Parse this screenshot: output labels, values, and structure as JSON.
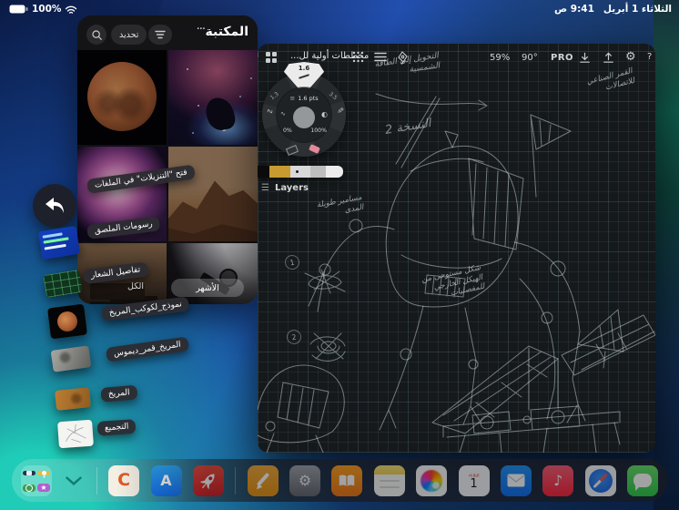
{
  "status_bar": {
    "battery_percent": "100%",
    "time": "9:41 ص",
    "date": "الثلاثاء 1 أبريل"
  },
  "photos": {
    "title": "المكتبة",
    "more_label": "···",
    "select_label": "تحديد",
    "tabs": {
      "all": "الكل",
      "months": "الأشهر"
    }
  },
  "concepts": {
    "title": "مخططات أولية لل...",
    "zoom_level": "59%",
    "rotation": "90°",
    "pro_label": "PRO",
    "help_label": "?",
    "layers_label": "Layers",
    "icons": {
      "menu": "☰",
      "stroke_lines": "≡",
      "squiggle": "∿",
      "contrast": "◐",
      "pen": "✎"
    },
    "tool_wheel": {
      "active_size": "1.6",
      "left_size": "1.3",
      "right_size": "3.5",
      "stroke_width": "1.6 pts",
      "opacity_min": "0%",
      "opacity_max": "100%"
    },
    "color_palette": [
      "#0b0b0b",
      "#c79b2f",
      "#d9d9d9",
      "#bdbdbd",
      "#ededed"
    ],
    "annotations": {
      "solar": "التحويل إلى الطاقة الشمسية",
      "satellite": "القمر الصناعي للاتصالات",
      "version": "النسخة 2",
      "long_pins": "مسامير طويلة المدى",
      "inspired": "شكل مستوحى من الهيكل الخارجي للمفصليات",
      "marker_1": "1",
      "marker_2": "2"
    }
  },
  "drag_items": [
    {
      "label": "فتح \"التنزيلات\" في الملفات"
    },
    {
      "label": "رسومات الملصق"
    },
    {
      "label": "تفاصيل الشعار"
    },
    {
      "label": "نموذج_لكوكب_المريخ"
    },
    {
      "label": "المريخ_قمر_ديموس"
    },
    {
      "label": "المريخ"
    },
    {
      "label": "التجميع"
    }
  ],
  "dock": {
    "calendar": {
      "weekday": "الثلاثاء",
      "day": "1"
    },
    "letters": {
      "concepts": "C",
      "app_store": "A"
    },
    "glyphs": {
      "settings": "⚙",
      "music": "♪",
      "star": "★"
    }
  }
}
